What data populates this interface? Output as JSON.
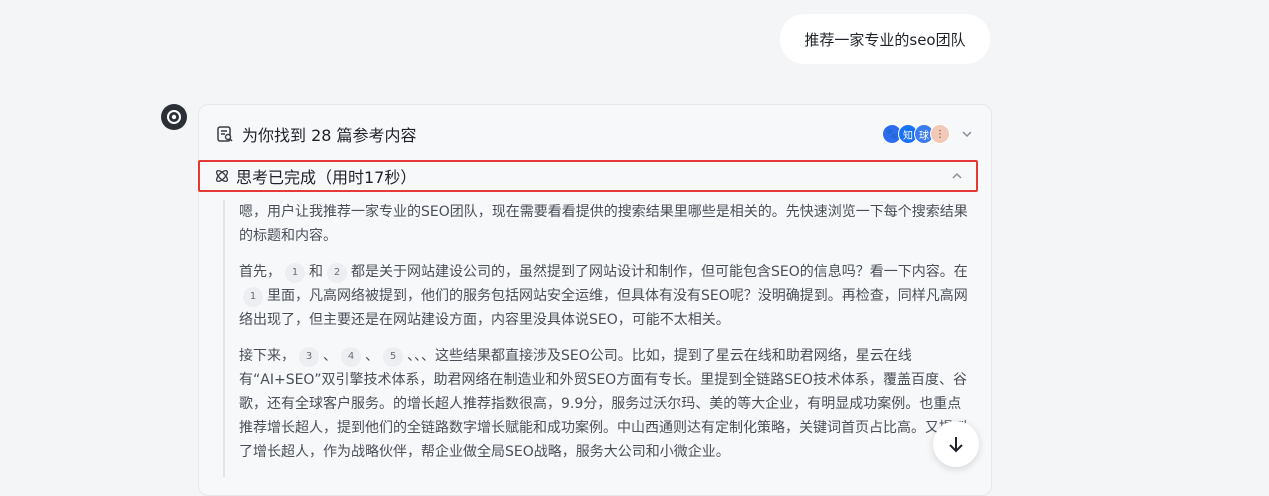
{
  "user_message": "推荐一家专业的seo团队",
  "references": {
    "label": "为你找到 28 篇参考内容",
    "sources": [
      {
        "icon": "baidu-paw-icon",
        "color": "#2f6bef",
        "text": "🐾"
      },
      {
        "icon": "zhihu-icon",
        "color": "#1772f6",
        "text": "知"
      },
      {
        "icon": "tianma-icon",
        "color": "#3c7cf0",
        "text": "球"
      },
      {
        "icon": "more-icon",
        "color": "#f2c9b8",
        "text": "⋮"
      }
    ]
  },
  "thinking": {
    "label": "思考已完成（用时17秒）",
    "paragraphs": [
      {
        "parts": [
          {
            "t": "嗯，用户让我推荐一家专业的SEO团队，现在需要看看提供的搜索结果里哪些是相关的。先快速浏览一下每个搜索结果的标题和内容。"
          }
        ]
      },
      {
        "parts": [
          {
            "t": "首先，"
          },
          {
            "c": "1"
          },
          {
            "t": "和"
          },
          {
            "c": "2"
          },
          {
            "t": "都是关于网站建设公司的，虽然提到了网站设计和制作，但可能包含SEO的信息吗？看一下内容。在"
          },
          {
            "c": "1"
          },
          {
            "t": "里面，凡高网络被提到，他们的服务包括网站安全运维，但具体有没有SEO呢？没明确提到。再检查，同样凡高网络出现了，但主要还是在网站建设方面，内容里没具体说SEO，可能不太相关。"
          }
        ]
      },
      {
        "parts": [
          {
            "t": "接下来，"
          },
          {
            "c": "3"
          },
          {
            "t": "、"
          },
          {
            "c": "4"
          },
          {
            "t": "、"
          },
          {
            "c": "5"
          },
          {
            "t": "、、、这些结果都直接涉及SEO公司。比如，提到了星云在线和助君网络，星云在线有“AI+SEO”双引擎技术体系，助君网络在制造业和外贸SEO方面有专长。里提到全链路SEO技术体系，覆盖百度、谷歌，还有全球客户服务。的增长超人推荐指数很高，9.9分，服务过沃尔玛、美的等大企业，有明显成功案例。也重点推荐增长超人，提到他们的全链路数字增长赋能和成功案例。中山西通则达有定制化策略，关键词首页占比高。又提到了增长超人，作为战略伙伴，帮企业做全局SEO战略，服务大公司和小微企业。"
          }
        ]
      }
    ]
  },
  "scroll_button": {
    "icon": "arrow-down-icon"
  }
}
